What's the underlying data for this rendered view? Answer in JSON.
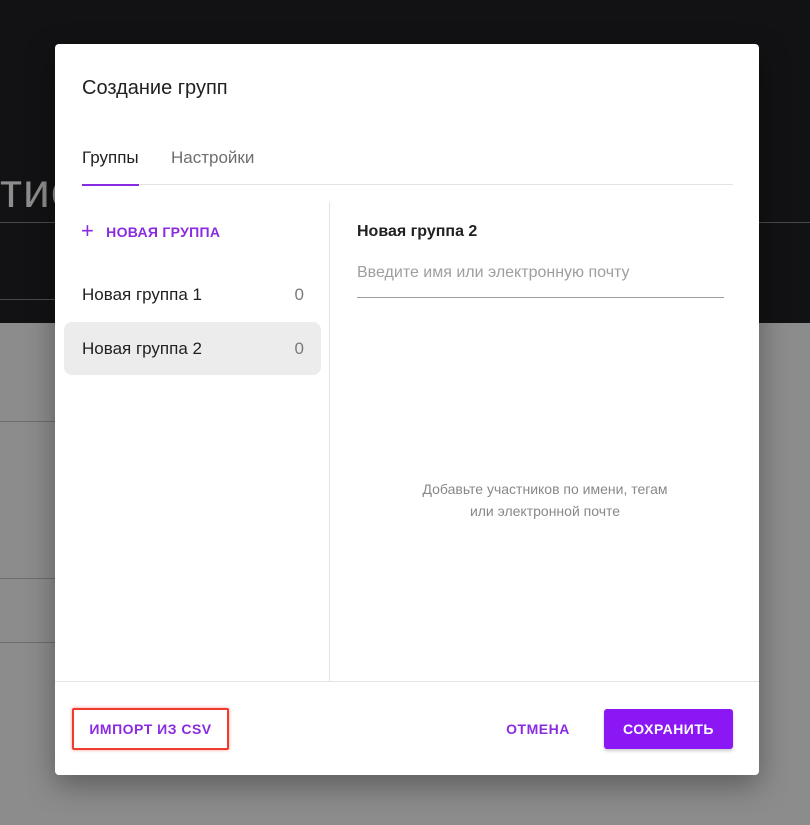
{
  "background": {
    "title_fragment": "тие"
  },
  "dialog": {
    "title": "Создание групп",
    "tabs": [
      {
        "label": "Группы",
        "active": true
      },
      {
        "label": "Настройки",
        "active": false
      }
    ],
    "new_group_label": "НОВАЯ ГРУППА",
    "groups": [
      {
        "name": "Новая группа 1",
        "count": "0",
        "selected": false
      },
      {
        "name": "Новая группа 2",
        "count": "0",
        "selected": true
      }
    ],
    "selected_group_title": "Новая группа 2",
    "member_input": {
      "placeholder": "Введите имя или электронную почту",
      "value": ""
    },
    "empty_hint_line1": "Добавьте участников по имени, тегам",
    "empty_hint_line2": "или электронной почте",
    "footer": {
      "import_label": "ИМПОРТ ИЗ CSV",
      "cancel_label": "ОТМЕНА",
      "save_label": "СОХРАНИТЬ"
    }
  },
  "colors": {
    "accent": "#8a2be2",
    "save_button": "#8c17f5",
    "highlight_border": "#f03a2e"
  }
}
